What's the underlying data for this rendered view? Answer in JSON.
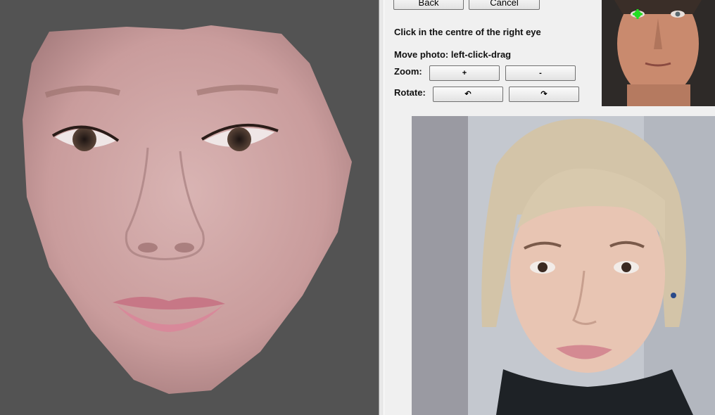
{
  "window": {
    "colors": {
      "viewport_bg": "#535353",
      "panel_bg": "#f0f0f0",
      "marker": "#22dd22"
    }
  },
  "toolbar": {
    "back_label": "Back",
    "cancel_label": "Cancel"
  },
  "instructions": {
    "step": "Click in the centre of the right eye",
    "move_hint": "Move photo: left-click-drag"
  },
  "zoom": {
    "label": "Zoom:",
    "in_label": "+",
    "out_label": "-"
  },
  "rotate": {
    "label": "Rotate:",
    "ccw_label": "↶",
    "cw_label": "↷"
  },
  "images": {
    "preview": "3d-face-mask",
    "reference": "reference-face-thumbnail",
    "photo": "portrait-photo"
  }
}
